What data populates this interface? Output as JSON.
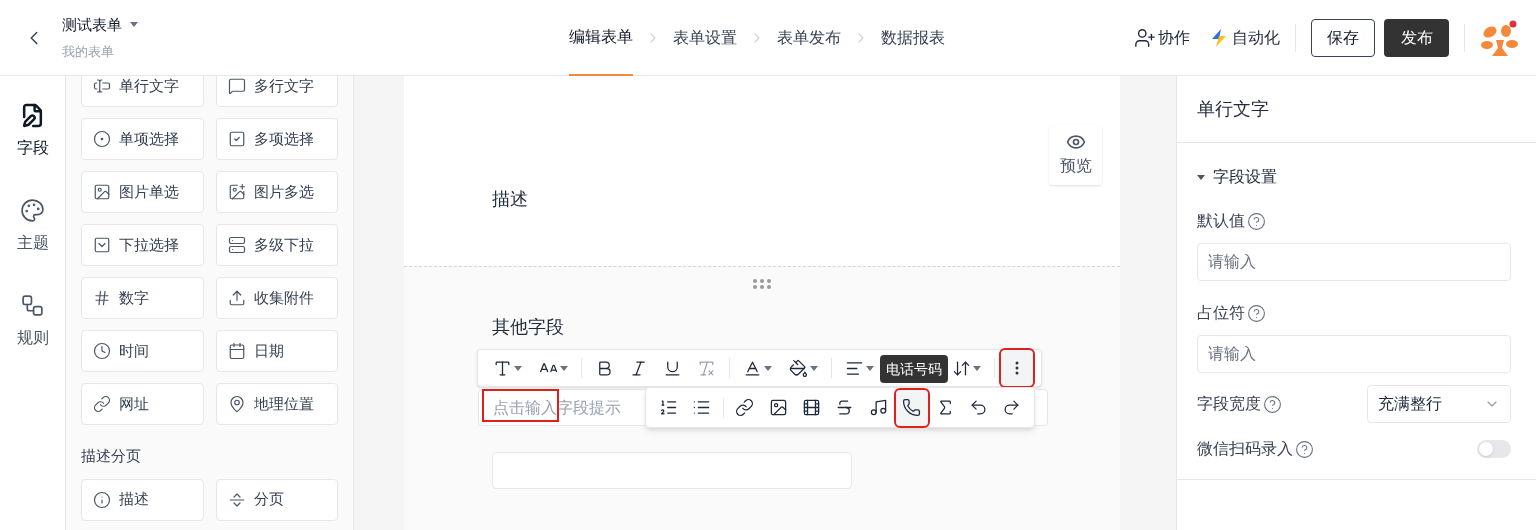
{
  "header": {
    "title": "测试表单",
    "subtitle": "我的表单",
    "steps": [
      {
        "label": "编辑表单",
        "selected": true
      },
      {
        "label": "表单设置",
        "selected": false
      },
      {
        "label": "表单发布",
        "selected": false
      },
      {
        "label": "数据报表",
        "selected": false
      }
    ],
    "collab": "协作",
    "automation": "自动化",
    "save": "保存",
    "publish": "发布",
    "notification": true
  },
  "rail": [
    {
      "kind": "field",
      "label": "字段",
      "selected": true
    },
    {
      "kind": "theme",
      "label": "主题",
      "selected": false
    },
    {
      "kind": "rule",
      "label": "规则",
      "selected": false
    }
  ],
  "palette": {
    "fields": [
      {
        "kind": "single-text",
        "label": "单行文字"
      },
      {
        "kind": "multi-text",
        "label": "多行文字"
      },
      {
        "kind": "radio",
        "label": "单项选择"
      },
      {
        "kind": "checkbox",
        "label": "多项选择"
      },
      {
        "kind": "image-single",
        "label": "图片单选"
      },
      {
        "kind": "image-multi",
        "label": "图片多选"
      },
      {
        "kind": "dropdown",
        "label": "下拉选择"
      },
      {
        "kind": "cascade",
        "label": "多级下拉"
      },
      {
        "kind": "number",
        "label": "数字"
      },
      {
        "kind": "upload",
        "label": "收集附件"
      },
      {
        "kind": "time",
        "label": "时间"
      },
      {
        "kind": "date",
        "label": "日期"
      },
      {
        "kind": "url",
        "label": "网址"
      },
      {
        "kind": "location",
        "label": "地理位置"
      }
    ],
    "section": "描述分页",
    "section_items": [
      {
        "kind": "description",
        "label": "描述"
      },
      {
        "kind": "page-break",
        "label": "分页"
      }
    ]
  },
  "canvas": {
    "preview": "预览",
    "description": "描述",
    "field_label": "其他字段",
    "field_placeholder": "点击输入字段提示",
    "placeholder_marked": true,
    "toolbar": [
      {
        "kind": "text",
        "caret": true,
        "active": false,
        "marked": false
      },
      {
        "kind": "font-size",
        "caret": true,
        "active": false,
        "marked": false
      },
      {
        "kind": "divider"
      },
      {
        "kind": "bold",
        "caret": false,
        "active": false,
        "marked": false
      },
      {
        "kind": "italic",
        "caret": false,
        "active": false,
        "marked": false
      },
      {
        "kind": "underline",
        "caret": false,
        "active": false,
        "marked": false
      },
      {
        "kind": "clear-format",
        "caret": false,
        "active": false,
        "marked": false
      },
      {
        "kind": "divider"
      },
      {
        "kind": "font-color",
        "caret": true,
        "active": false,
        "marked": false
      },
      {
        "kind": "fill-color",
        "caret": true,
        "active": false,
        "marked": false
      },
      {
        "kind": "divider"
      },
      {
        "kind": "align",
        "caret": true,
        "active": false,
        "marked": false
      },
      {
        "kind": "spacer"
      },
      {
        "kind": "line-height",
        "caret": true,
        "active": false,
        "marked": false
      },
      {
        "kind": "divider"
      },
      {
        "kind": "more",
        "caret": false,
        "active": true,
        "marked": true
      }
    ],
    "more_toolbar": [
      {
        "kind": "ordered-list",
        "active": false,
        "marked": false
      },
      {
        "kind": "bullet-list",
        "active": false,
        "marked": false
      },
      {
        "kind": "divider"
      },
      {
        "kind": "link",
        "active": false,
        "marked": false
      },
      {
        "kind": "image",
        "active": false,
        "marked": false
      },
      {
        "kind": "video",
        "active": false,
        "marked": false
      },
      {
        "kind": "strike",
        "active": false,
        "marked": false
      },
      {
        "kind": "audio",
        "active": false,
        "marked": false
      },
      {
        "kind": "phone",
        "active": true,
        "marked": true
      },
      {
        "kind": "formula",
        "active": false,
        "marked": false
      },
      {
        "kind": "undo",
        "active": false,
        "marked": false
      },
      {
        "kind": "redo",
        "active": false,
        "marked": false
      }
    ],
    "tooltip": "电话号码"
  },
  "settings": {
    "title": "单行文字",
    "section": "字段设置",
    "expanded": true,
    "default_label": "默认值",
    "default_placeholder": "请输入",
    "placeholder_label": "占位符",
    "placeholder_placeholder": "请输入",
    "width_label": "字段宽度",
    "width_value": "充满整行",
    "wechat_label": "微信扫码录入",
    "wechat_on": false
  }
}
